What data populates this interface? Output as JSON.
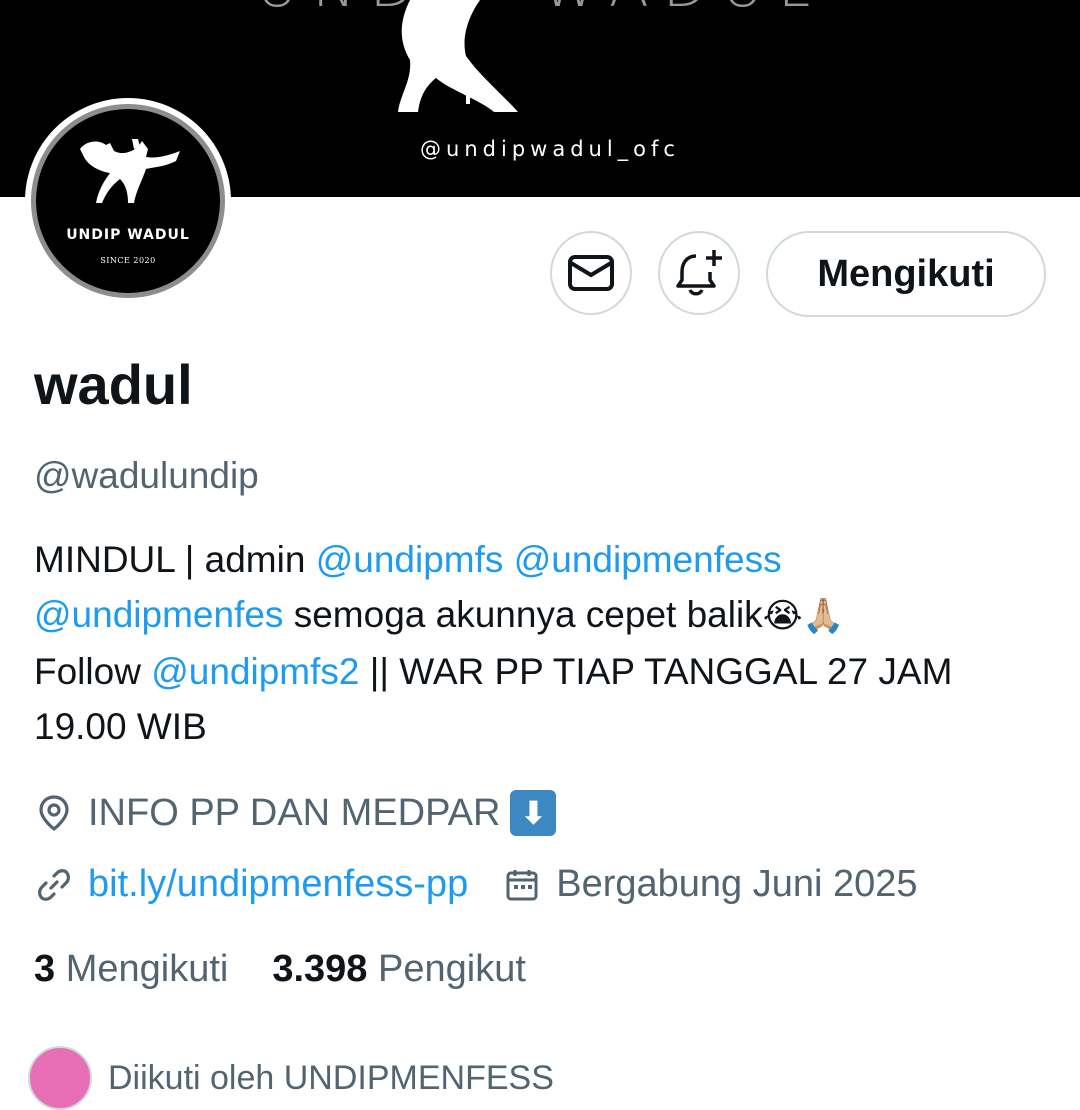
{
  "banner": {
    "title": "UNDIP WADUL",
    "handle": "@undipwadul_ofc"
  },
  "avatar": {
    "name": "UNDIP WADUL",
    "since": "SINCE 2020"
  },
  "actions": {
    "message_icon": "mail-icon",
    "notify_icon": "bell-plus-icon",
    "follow_label": "Mengikuti"
  },
  "profile": {
    "name": "wadul",
    "handle": "@wadulundip",
    "bio": {
      "t1": "MINDUL | admin ",
      "m1": "@undipmfs",
      "t2": " ",
      "m2": "@undipmenfess",
      "m3": "@undipmenfes",
      "t3": "  semoga akunnya cepet balik",
      "emoji1": "😭",
      "emoji2": "🙏🏼",
      "t4": "Follow ",
      "m4": "@undipmfs2",
      "t5": " || WAR PP TIAP TANGGAL 27 JAM 19.00 WIB"
    },
    "location": "INFO PP DAN MEDPAR",
    "location_emoji": "⬇",
    "link": "bit.ly/undipmenfess-pp",
    "joined": "Bergabung Juni 2025",
    "following_count": "3",
    "following_label": "Mengikuti",
    "followers_count": "3.398",
    "followers_label": "Pengikut",
    "followed_by": "Diikuti oleh UNDIPMENFESS"
  },
  "colors": {
    "accent": "#1d9bf0",
    "secondary_text": "#536471",
    "border": "#cfd9de"
  }
}
